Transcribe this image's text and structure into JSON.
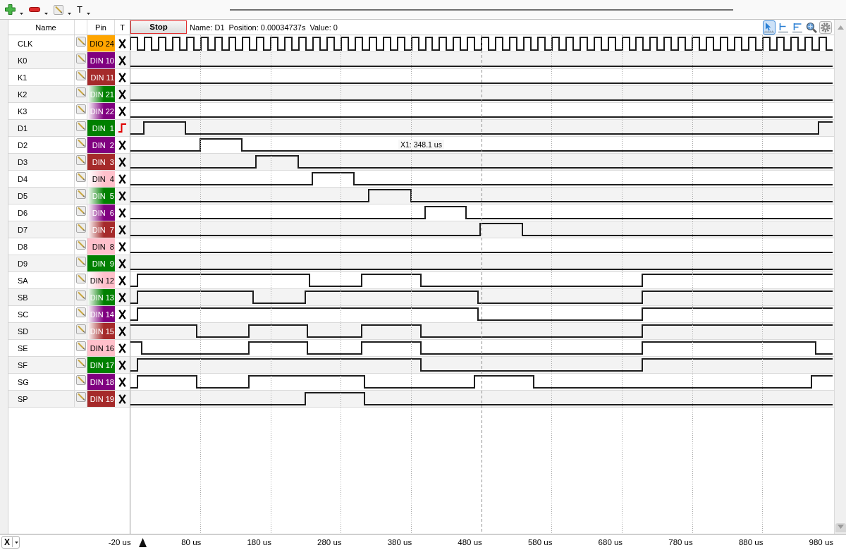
{
  "toolbar": {
    "buttons": [
      {
        "kind": "add"
      },
      {
        "kind": "remove"
      },
      {
        "kind": "edit"
      },
      {
        "kind": "text",
        "label": "T"
      }
    ]
  },
  "table": {
    "columns": [
      "Name",
      "Pin",
      "T"
    ],
    "stop_button": "Stop",
    "status": {
      "name": "Name: D1",
      "position": "Position: 0.00034737s",
      "value": "Value: 0"
    },
    "tools": [
      {
        "kind": "select",
        "selected": true
      },
      {
        "kind": "cursor_one",
        "selected": false
      },
      {
        "kind": "cursor_two",
        "selected": false
      },
      {
        "kind": "zoom",
        "selected": false
      },
      {
        "kind": "settings",
        "selected": false
      }
    ],
    "signals": [
      {
        "name": "CLK",
        "pin": "DIO 24",
        "color": "#ffa500",
        "faded": false,
        "trigger": {
          "kind": "any"
        }
      },
      {
        "name": "K0",
        "pin": "DIN 10",
        "color": "#800080",
        "faded": false,
        "trigger": {
          "kind": "any"
        }
      },
      {
        "name": "K1",
        "pin": "DIN 11",
        "color": "#a52a2a",
        "faded": false,
        "trigger": {
          "kind": "any"
        }
      },
      {
        "name": "K2",
        "pin": "DIN 21",
        "color": "#008000",
        "faded": true,
        "trigger": {
          "kind": "any"
        }
      },
      {
        "name": "K3",
        "pin": "DIN 22",
        "color": "#800080",
        "faded": true,
        "trigger": {
          "kind": "any"
        }
      },
      {
        "name": "D1",
        "pin": "DIN  1",
        "color": "#008000",
        "faded": false,
        "trigger": {
          "kind": "rising"
        }
      },
      {
        "name": "D2",
        "pin": "DIN  2",
        "color": "#800080",
        "faded": false,
        "trigger": {
          "kind": "any"
        }
      },
      {
        "name": "D3",
        "pin": "DIN  3",
        "color": "#a52a2a",
        "faded": false,
        "trigger": {
          "kind": "any"
        }
      },
      {
        "name": "D4",
        "pin": "DIN  4",
        "color": "#ffc0cb",
        "faded": true,
        "trigger": {
          "kind": "any"
        }
      },
      {
        "name": "D5",
        "pin": "DIN  5",
        "color": "#008000",
        "faded": true,
        "trigger": {
          "kind": "any"
        }
      },
      {
        "name": "D6",
        "pin": "DIN  6",
        "color": "#800080",
        "faded": true,
        "trigger": {
          "kind": "any"
        }
      },
      {
        "name": "D7",
        "pin": "DIN  7",
        "color": "#a52a2a",
        "faded": true,
        "trigger": {
          "kind": "any"
        }
      },
      {
        "name": "D8",
        "pin": "DIN  8",
        "color": "#ffc0cb",
        "faded": false,
        "trigger": {
          "kind": "any"
        }
      },
      {
        "name": "D9",
        "pin": "DIN  9",
        "color": "#008000",
        "faded": false,
        "trigger": {
          "kind": "any"
        }
      },
      {
        "name": "SA",
        "pin": "DIN 12",
        "color": "#ffc0cb",
        "faded": true,
        "trigger": {
          "kind": "any"
        }
      },
      {
        "name": "SB",
        "pin": "DIN 13",
        "color": "#008000",
        "faded": true,
        "trigger": {
          "kind": "any"
        }
      },
      {
        "name": "SC",
        "pin": "DIN 14",
        "color": "#800080",
        "faded": true,
        "trigger": {
          "kind": "any"
        }
      },
      {
        "name": "SD",
        "pin": "DIN 15",
        "color": "#a52a2a",
        "faded": true,
        "trigger": {
          "kind": "any"
        }
      },
      {
        "name": "SE",
        "pin": "DIN 16",
        "color": "#ffc0cb",
        "faded": false,
        "trigger": {
          "kind": "any"
        }
      },
      {
        "name": "SF",
        "pin": "DIN 17",
        "color": "#008000",
        "faded": false,
        "trigger": {
          "kind": "any"
        }
      },
      {
        "name": "SG",
        "pin": "DIN 18",
        "color": "#800080",
        "faded": false,
        "trigger": {
          "kind": "any"
        }
      },
      {
        "name": "SP",
        "pin": "DIN 19",
        "color": "#a52a2a",
        "faded": false,
        "trigger": {
          "kind": "any"
        }
      }
    ],
    "cursor_label": "X1: 348.1 us"
  },
  "time_axis": {
    "selector": "X",
    "labels": [
      "-20 us",
      "80 us",
      "180 us",
      "280 us",
      "380 us",
      "480 us",
      "580 us",
      "680 us",
      "780 us",
      "880 us",
      "980 us"
    ]
  }
}
